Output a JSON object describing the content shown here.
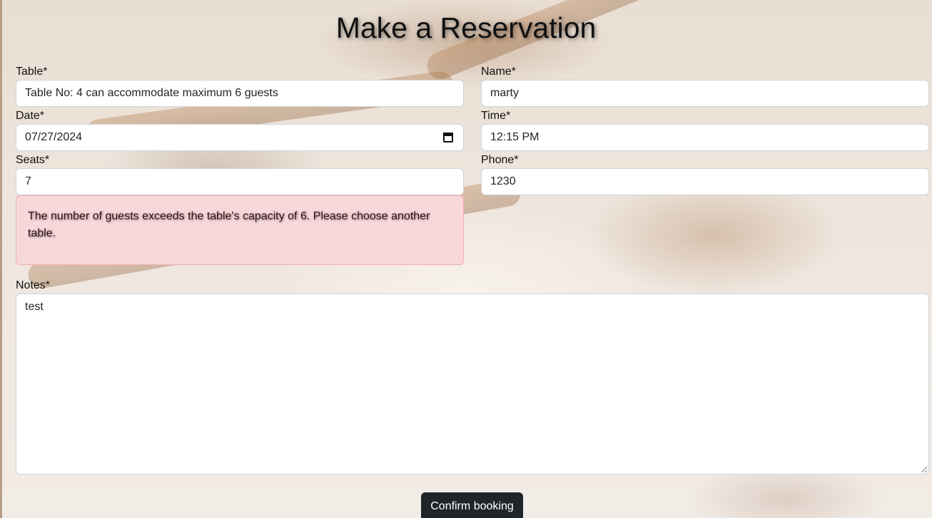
{
  "page": {
    "title": "Make a Reservation"
  },
  "form": {
    "table": {
      "label": "Table*",
      "value": "Table No: 4 can accommodate maximum 6 guests"
    },
    "name": {
      "label": "Name*",
      "value": "marty"
    },
    "date": {
      "label": "Date*",
      "value": "07/27/2024"
    },
    "time": {
      "label": "Time*",
      "value": "12:15 PM"
    },
    "seats": {
      "label": "Seats*",
      "value": "7"
    },
    "phone": {
      "label": "Phone*",
      "value": "1230"
    },
    "error_message": "The number of guests exceeds the table's capacity of 6. Please choose another table.",
    "notes": {
      "label": "Notes*",
      "value": "test"
    },
    "confirm_label": "Confirm booking"
  },
  "colors": {
    "error_bg": "#f8d7da",
    "error_border": "#f1aeb5",
    "button_bg": "#212529"
  },
  "icons": {
    "date_picker": "calendar-icon"
  }
}
